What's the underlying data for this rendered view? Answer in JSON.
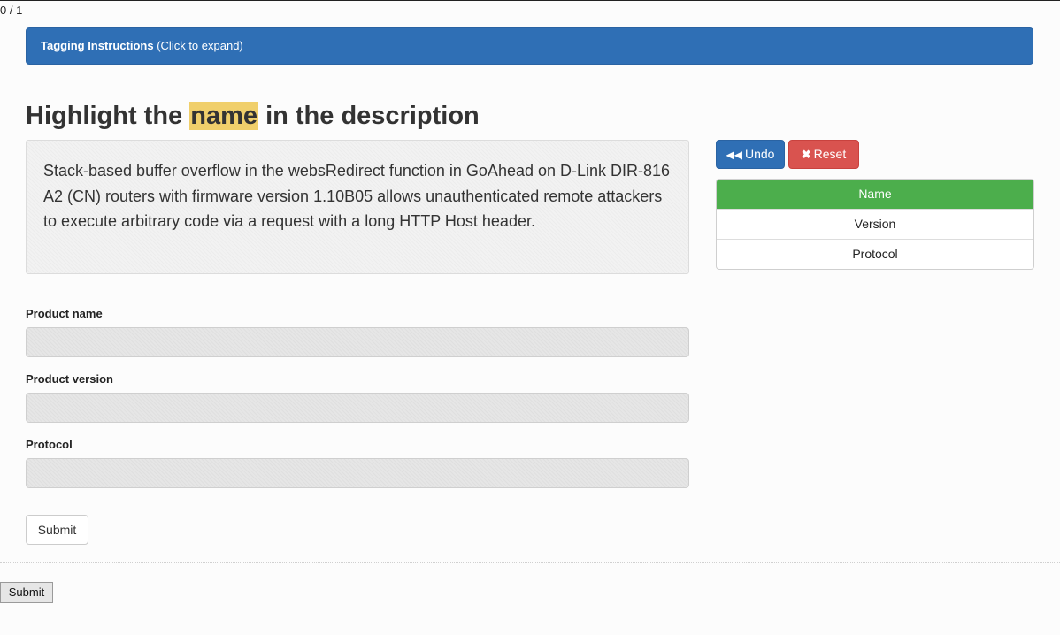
{
  "progress": {
    "counter": "0 / 1"
  },
  "instructions": {
    "title": "Tagging Instructions",
    "hint": "(Click to expand)"
  },
  "task": {
    "prefix": "Highlight the ",
    "target": "name",
    "suffix": " in the description"
  },
  "description": {
    "text": "Stack-based buffer overflow in the websRedirect function in GoAhead on D-Link DIR-816 A2 (CN) routers with firmware version 1.10B05 allows unauthenticated remote attackers to execute arbitrary code via a request with a long HTTP Host header."
  },
  "toolbar": {
    "undo_label": "Undo",
    "reset_label": "Reset"
  },
  "labels": {
    "items": [
      "Name",
      "Version",
      "Protocol"
    ],
    "selected": "Name"
  },
  "form": {
    "fields": [
      {
        "label": "Product name",
        "value": ""
      },
      {
        "label": "Product version",
        "value": ""
      },
      {
        "label": "Protocol",
        "value": ""
      }
    ],
    "submit_label": "Submit"
  },
  "footer": {
    "submit_label": "Submit"
  },
  "colors": {
    "primary": "#2f6fb5",
    "danger": "#d9534f",
    "success": "#4cae4c",
    "highlight": "#f0cf6b"
  },
  "icons": {
    "undo": "fast-backward-icon",
    "reset": "close-icon"
  }
}
